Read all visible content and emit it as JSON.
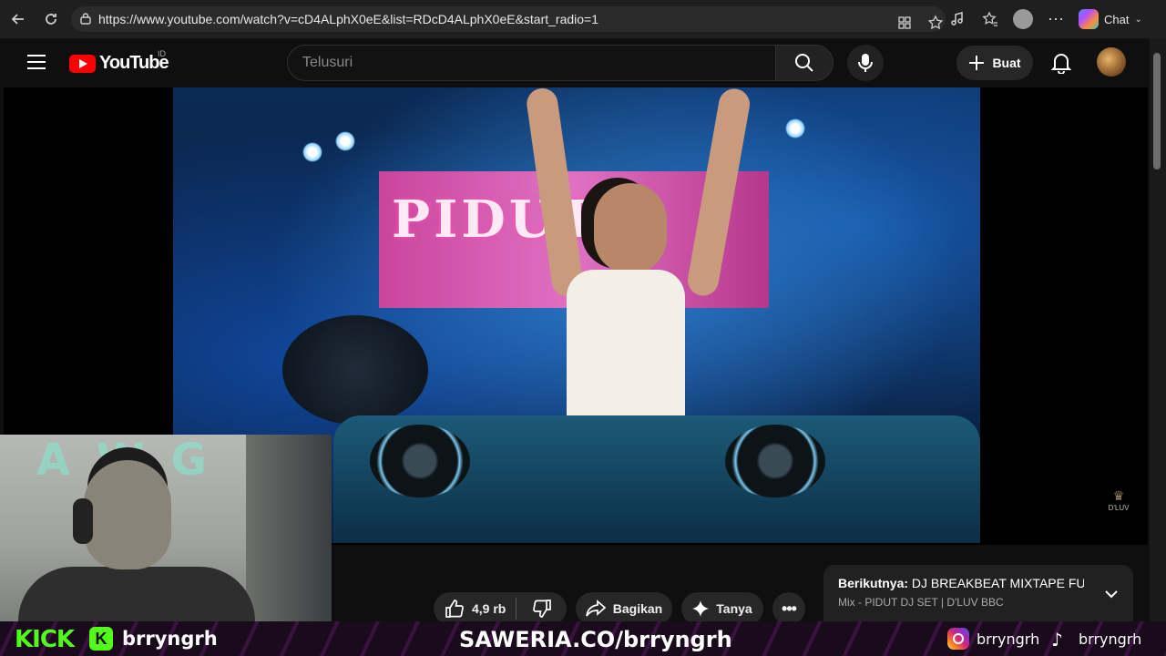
{
  "browser": {
    "url": "https://www.youtube.com/watch?v=cD4ALphX0eE&list=RDcD4ALphX0eE&start_radio=1",
    "chat_label": "Chat"
  },
  "header": {
    "logo_text": "YouTube",
    "region": "ID",
    "search_placeholder": "Telusuri",
    "create_label": "Buat"
  },
  "video": {
    "screen_text": "PIDUTG"
  },
  "actions": {
    "like_count": "4,9 rb",
    "share_label": "Bagikan",
    "ask_label": "Tanya"
  },
  "up_next": {
    "prefix": "Berikutnya:",
    "title": "DJ BREAKBEAT MIXTAPE FU...",
    "subtitle": "Mix - PIDUT DJ SET | D'LUV BBC"
  },
  "overlay": {
    "kick_logo": "KICK",
    "kick_username": "brryngrh",
    "saweria": "SAWERIA.CO/brryngrh",
    "instagram": "brryngrh",
    "tiktok": "brryngrh",
    "watermark": "D'LUV"
  },
  "colors": {
    "youtube_red": "#ff0000",
    "kick_green": "#53fc18",
    "background": "#0f0f0f"
  }
}
